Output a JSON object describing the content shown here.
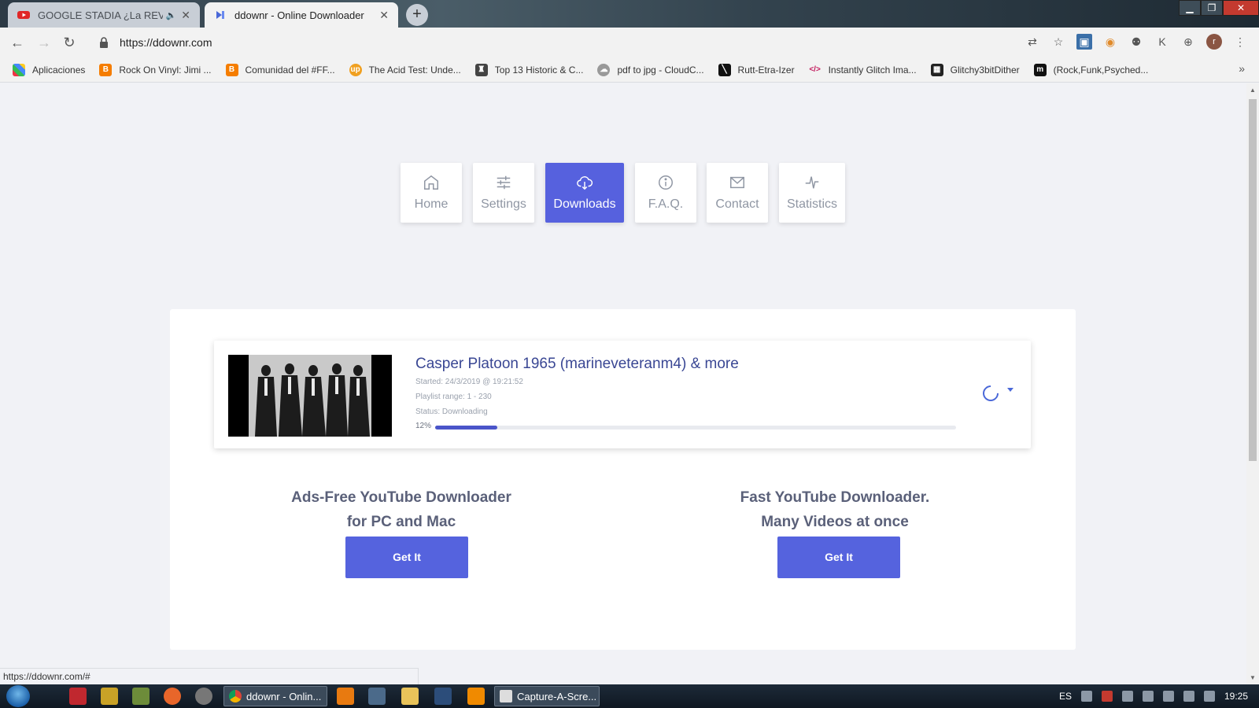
{
  "browser": {
    "tabs": [
      {
        "title": "GOOGLE STADIA ¿La REVOLU",
        "active": false,
        "favicon": "youtube-icon",
        "audio": true
      },
      {
        "title": "ddownr - Online Downloader",
        "active": true,
        "favicon": "ddownr-icon"
      }
    ],
    "new_tab_label": "+",
    "url": "https://ddownr.com",
    "bookmarks": [
      {
        "label": "Aplicaciones",
        "icon": "apps-grid-icon"
      },
      {
        "label": "Rock On Vinyl: Jimi ...",
        "icon": "blogger-icon"
      },
      {
        "label": "Comunidad del #FF...",
        "icon": "blogger-icon"
      },
      {
        "label": "The Acid Test: Unde...",
        "icon": "up-icon"
      },
      {
        "label": "Top 13 Historic & C...",
        "icon": "person-icon"
      },
      {
        "label": "pdf to jpg - CloudC...",
        "icon": "cloud-icon"
      },
      {
        "label": "Rutt-Etra-Izer",
        "icon": "black-square-icon"
      },
      {
        "label": "Instantly Glitch Ima...",
        "icon": "code-icon"
      },
      {
        "label": "Glitchy3bitDither",
        "icon": "clapper-icon"
      },
      {
        "label": "(Rock,Funk,Psyched...",
        "icon": "m-icon"
      }
    ],
    "more_bookmarks": "»",
    "avatar_letter": "r",
    "status_url": "https://ddownr.com/#"
  },
  "nav": {
    "items": [
      {
        "label": "Home",
        "icon": "home-icon",
        "active": false
      },
      {
        "label": "Settings",
        "icon": "sliders-icon",
        "active": false
      },
      {
        "label": "Downloads",
        "icon": "cloud-download-icon",
        "active": true
      },
      {
        "label": "F.A.Q.",
        "icon": "info-icon",
        "active": false
      },
      {
        "label": "Contact",
        "icon": "mail-icon",
        "active": false
      },
      {
        "label": "Statistics",
        "icon": "activity-icon",
        "active": false
      }
    ]
  },
  "download": {
    "title": "Casper Platoon 1965 (marineveteranm4) & more",
    "started": "Started: 24/3/2019 @ 19:21:52",
    "playlist_range": "Playlist range: 1 - 230",
    "status": "Status: Downloading",
    "progress_label": "12%",
    "progress": 0.12
  },
  "promos": [
    {
      "line1": "Ads-Free YouTube Downloader",
      "line2": "for PC and Mac",
      "button": "Get It"
    },
    {
      "line1": "Fast YouTube Downloader.",
      "line2": "Many Videos at once",
      "button": "Get It"
    }
  ],
  "taskbar": {
    "tasks": [
      {
        "label": "ddownr - Onlin..."
      },
      {
        "label": "Capture-A-Scre..."
      }
    ],
    "language": "ES",
    "clock": "19:25"
  },
  "colors": {
    "accent": "#5661de",
    "title": "#3a4794",
    "page_bg": "#f1f2f6"
  }
}
